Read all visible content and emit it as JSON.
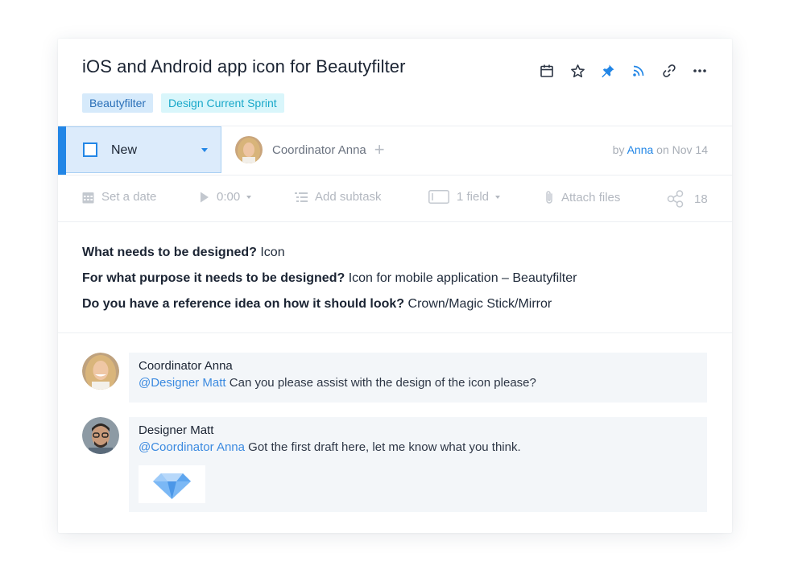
{
  "task": {
    "title": "iOS and Android app icon for Beautyfilter",
    "tags": [
      "Beautyfilter",
      "Design Current Sprint"
    ],
    "top_icons": [
      "calendar-icon",
      "star-icon",
      "pin-icon",
      "rss-icon",
      "link-icon",
      "more-icon"
    ],
    "status": "New",
    "assignee": "Coordinator Anna",
    "byline": {
      "prefix": "by",
      "author": "Anna",
      "date_text": "on Nov 14"
    },
    "colors": {
      "accent": "#2286e6",
      "tag1_bg": "#d6eafb",
      "tag2_bg": "#d9f6fb"
    }
  },
  "toolbar": {
    "date": "Set a date",
    "timer": "0:00",
    "subtask": "Add subtask",
    "field": "1 field",
    "attach": "Attach files",
    "shares": "18"
  },
  "description": [
    {
      "q": "What needs to be designed?",
      "a": "Icon"
    },
    {
      "q": "For what purpose it needs to be designed?",
      "a": "Icon for mobile application – Beautyfilter"
    },
    {
      "q": "Do you have a reference idea on how it should look?",
      "a": "Crown/Magic Stick/Mirror"
    }
  ],
  "comments": [
    {
      "author": "Coordinator Anna",
      "mention": "@Designer Matt",
      "text": "Can you please assist with the design of the icon please?"
    },
    {
      "author": "Designer Matt",
      "mention": "@Coordinator Anna",
      "text": "Got the first draft here, let me know what you think.",
      "attachment_icon": "diamond-icon"
    }
  ]
}
